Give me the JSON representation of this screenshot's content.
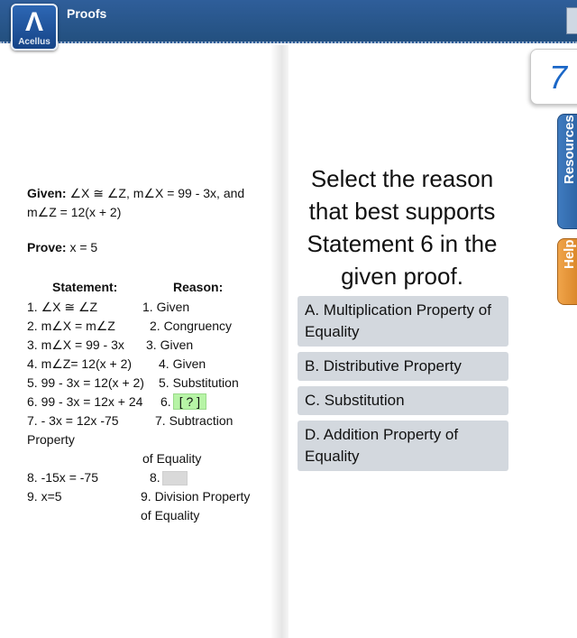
{
  "header": {
    "logo_text": "Acellus",
    "title": "Proofs"
  },
  "sidebar_tabs": {
    "question_number": "7",
    "resources_label": "Resources",
    "help_label": "Help"
  },
  "proof": {
    "given_label": "Given:",
    "given_line1": "∠X ≅ ∠Z, m∠X = 99 - 3x, and",
    "given_line2": "m∠Z = 12(x + 2)",
    "prove_label": "Prove:",
    "prove_text": "x = 5",
    "statement_header": "Statement:",
    "reason_header": "Reason:",
    "statements": [
      "1. ∠X ≅ ∠Z",
      "2. m∠X = m∠Z",
      "3. m∠X = 99 - 3x",
      "4. m∠Z= 12(x + 2)",
      "5. 99 - 3x = 12(x + 2)",
      "6. 99 - 3x = 12x + 24",
      "7. - 3x = 12x -75",
      "Property",
      "8. -15x = -75",
      "9.  x=5"
    ],
    "reasons": [
      "1. Given",
      "2. Congruency",
      "3. Given",
      "4. Given",
      "5. Substitution",
      "6.",
      "7. Subtraction",
      "of Equality",
      "8.",
      "9. Division Property",
      "of Equality"
    ],
    "blank_6": "?"
  },
  "question": {
    "text": "Select the reason that best supports Statement 6 in the given proof."
  },
  "options": [
    "A.  Multiplication Property of Equality",
    "B.  Distributive Property",
    "C.  Substitution",
    "D.  Addition Property of Equality"
  ]
}
